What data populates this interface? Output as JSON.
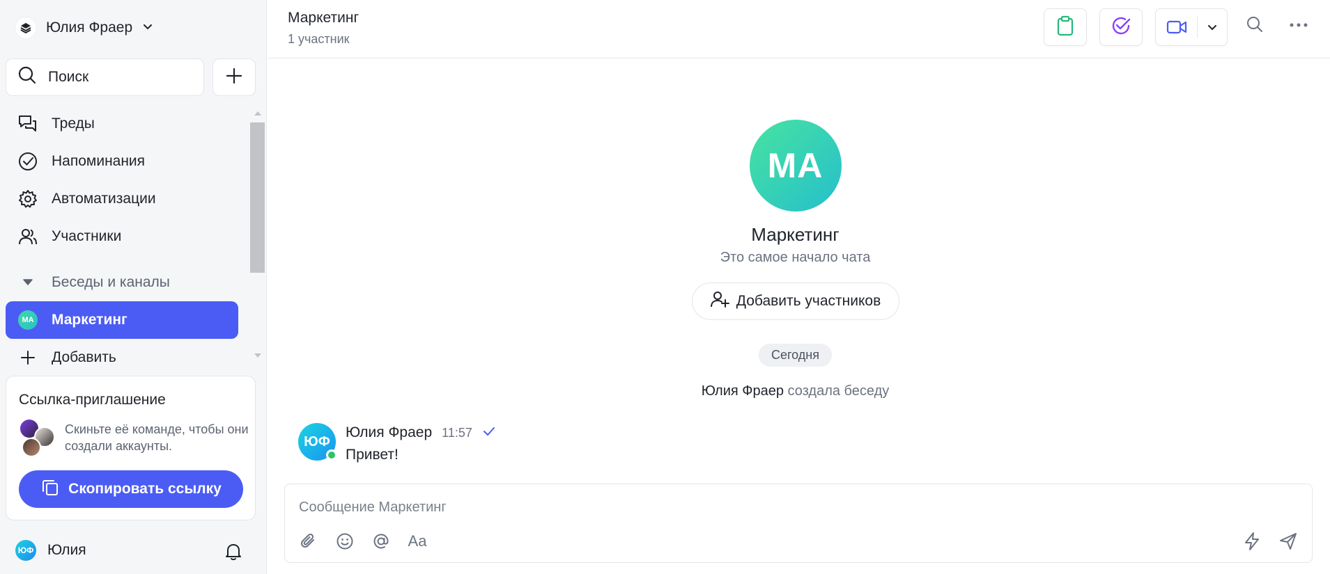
{
  "workspace": {
    "name": "Юлия Фраер"
  },
  "search": {
    "label": "Поиск"
  },
  "nav": {
    "items": [
      {
        "label": "Треды",
        "icon": "threads-icon"
      },
      {
        "label": "Напоминания",
        "icon": "check-circle-icon"
      },
      {
        "label": "Автоматизации",
        "icon": "gear-icon"
      },
      {
        "label": "Участники",
        "icon": "users-icon"
      }
    ],
    "section": "Беседы и каналы",
    "channel": {
      "label": "Маркетинг",
      "avatar": "MA"
    },
    "add": "Добавить"
  },
  "invite": {
    "title": "Ссылка-приглашение",
    "text": "Скиньте её команде, чтобы они создали аккаунты.",
    "button": "Скопировать ссылку"
  },
  "user": {
    "name": "Юлия",
    "initials": "ЮФ"
  },
  "header": {
    "title": "Маркетинг",
    "subtitle": "1 участник"
  },
  "chat_intro": {
    "avatar": "MA",
    "title": "Маркетинг",
    "subtitle": "Это самое начало чата",
    "add_members": "Добавить участников"
  },
  "date_divider": "Сегодня",
  "system_message": {
    "author": "Юлия Фраер",
    "text": "создала беседу"
  },
  "message": {
    "initials": "ЮФ",
    "author": "Юлия Фраер",
    "time": "11:57",
    "text": "Привет!"
  },
  "composer": {
    "placeholder": "Сообщение Маркетинг",
    "format_label": "Aa"
  },
  "colors": {
    "accent": "#4b5cf5",
    "online": "#2bc36b",
    "clipboard": "#26b87a",
    "tasks": "#8a3ffc",
    "video": "#4b5cf5"
  }
}
